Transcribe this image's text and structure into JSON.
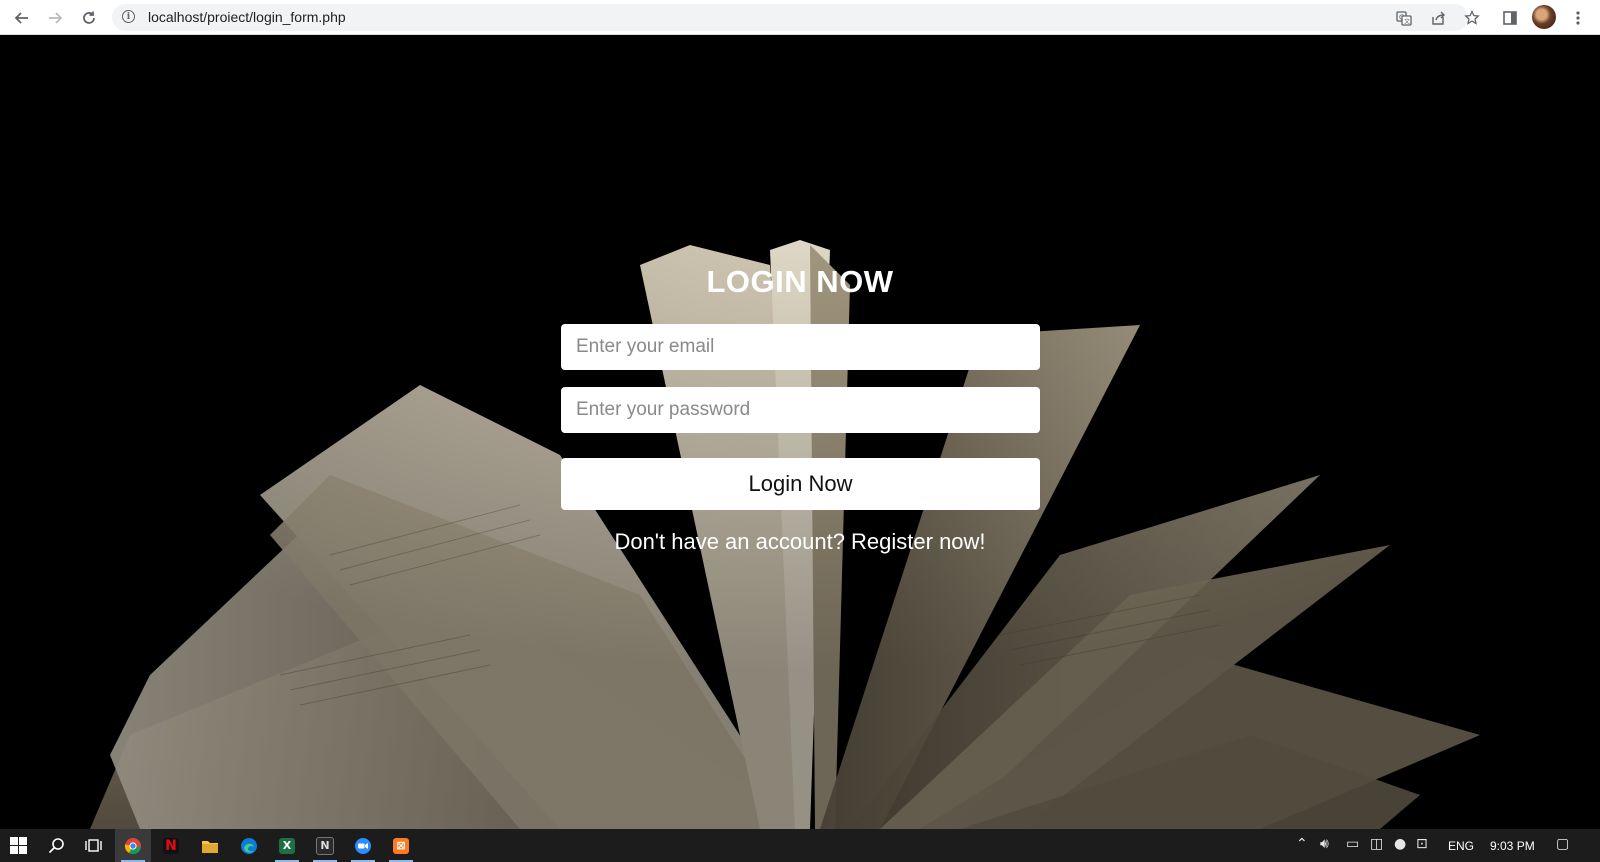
{
  "browser": {
    "url": "localhost/proiect/login_form.php",
    "icons": {
      "back": "arrow-left",
      "forward": "arrow-right",
      "reload": "reload",
      "site_info": "info",
      "translate": "translate",
      "share": "share",
      "bookmark": "star",
      "side_panel": "side-panel",
      "menu": "kebab-menu"
    }
  },
  "login": {
    "title": "LOGIN NOW",
    "email_placeholder": "Enter your email",
    "password_placeholder": "Enter your password",
    "submit_label": "Login Now",
    "register_text": "Don't have an account? Register now!"
  },
  "taskbar": {
    "apps": [
      {
        "name": "chrome",
        "active": true
      },
      {
        "name": "netflix",
        "active": false
      },
      {
        "name": "file-explorer",
        "active": false
      },
      {
        "name": "edge",
        "active": false
      },
      {
        "name": "excel",
        "active": false
      },
      {
        "name": "notion",
        "active": false
      },
      {
        "name": "zoom",
        "active": false
      },
      {
        "name": "xampp",
        "active": false
      }
    ],
    "language": "ENG",
    "time": "9:03 PM"
  },
  "colors": {
    "page_background": "#000000",
    "page_text": "#ffffff",
    "input_background": "#ffffff",
    "taskbar": "#1c1c1c"
  }
}
